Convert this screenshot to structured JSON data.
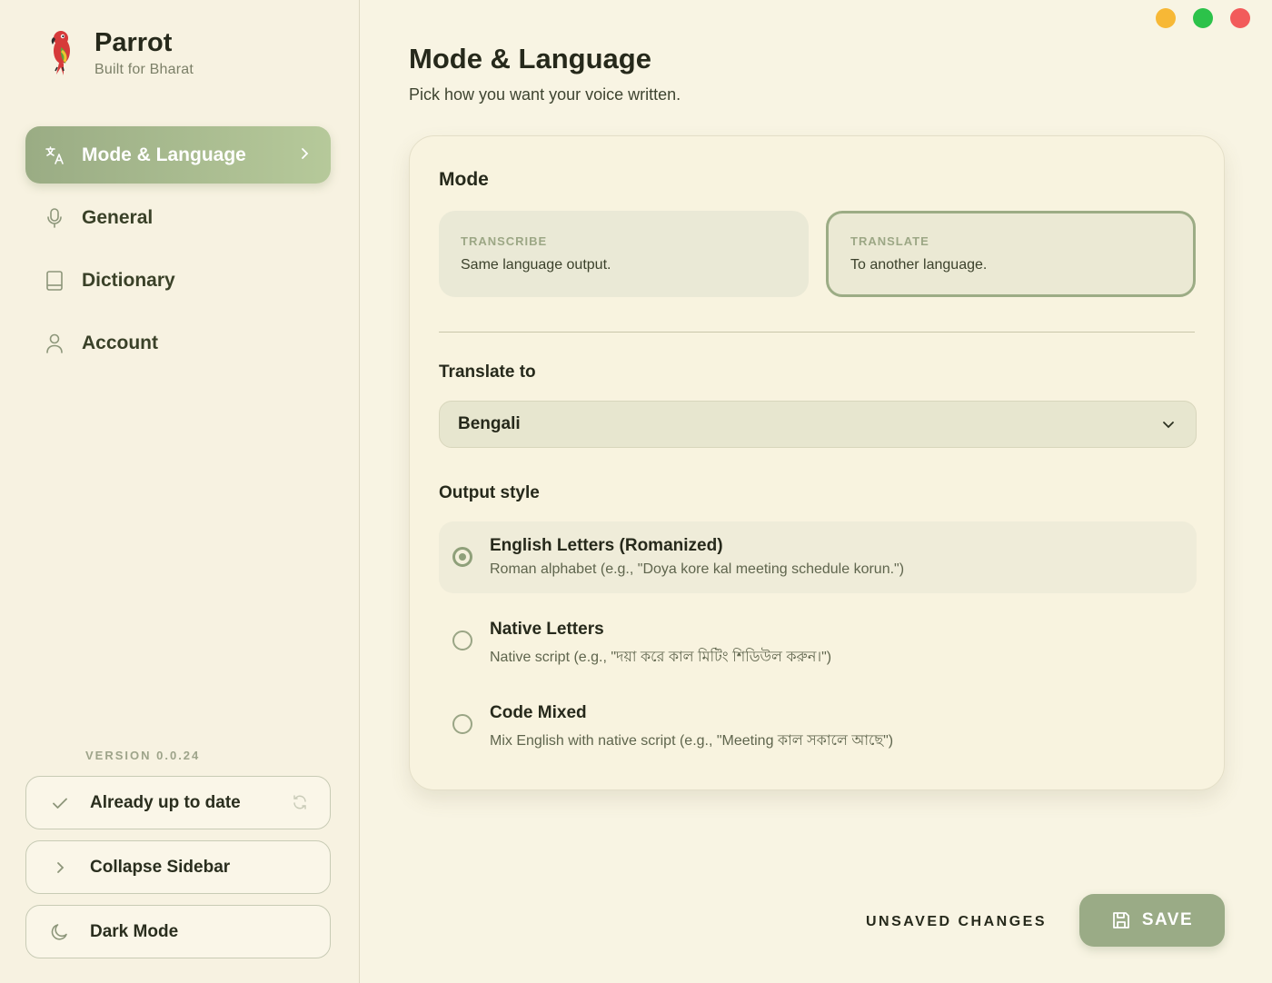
{
  "window": {
    "controls": [
      {
        "name": "minimize",
        "color": "#f7b836"
      },
      {
        "name": "maximize",
        "color": "#2cc24a"
      },
      {
        "name": "close",
        "color": "#f25b5b"
      }
    ]
  },
  "brand": {
    "name": "Parrot",
    "tagline": "Built for Bharat",
    "logo_icon": "parrot-logo"
  },
  "sidebar": {
    "items": [
      {
        "label": "Mode & Language",
        "icon": "translate-icon",
        "active": true
      },
      {
        "label": "General",
        "icon": "microphone-icon",
        "active": false
      },
      {
        "label": "Dictionary",
        "icon": "book-icon",
        "active": false
      },
      {
        "label": "Account",
        "icon": "user-icon",
        "active": false
      }
    ],
    "version": "VERSION 0.0.24",
    "update_status": "Already up to date",
    "collapse_label": "Collapse Sidebar",
    "dark_mode_label": "Dark Mode"
  },
  "page": {
    "title": "Mode & Language",
    "subtitle": "Pick how you want your voice written."
  },
  "mode": {
    "heading": "Mode",
    "options": [
      {
        "kicker": "TRANSCRIBE",
        "description": "Same language output.",
        "selected": false
      },
      {
        "kicker": "TRANSLATE",
        "description": "To another language.",
        "selected": true
      }
    ]
  },
  "translate_to": {
    "label": "Translate to",
    "value": "Bengali"
  },
  "output_style": {
    "label": "Output style",
    "options": [
      {
        "title": "English Letters (Romanized)",
        "description": "Roman alphabet (e.g., \"Doya kore kal meeting schedule korun.\")",
        "selected": true
      },
      {
        "title": "Native Letters",
        "description": "Native script (e.g., \"দয়া করে কাল মিটিং শিডিউল করুন।\")",
        "selected": false
      },
      {
        "title": "Code Mixed",
        "description": "Mix English with native script (e.g., \"Meeting কাল সকালে আছে\")",
        "selected": false
      }
    ]
  },
  "footer": {
    "status": "UNSAVED CHANGES",
    "save_label": "SAVE"
  },
  "colors": {
    "accent": "#9aab86",
    "background": "#f8f4e3"
  }
}
